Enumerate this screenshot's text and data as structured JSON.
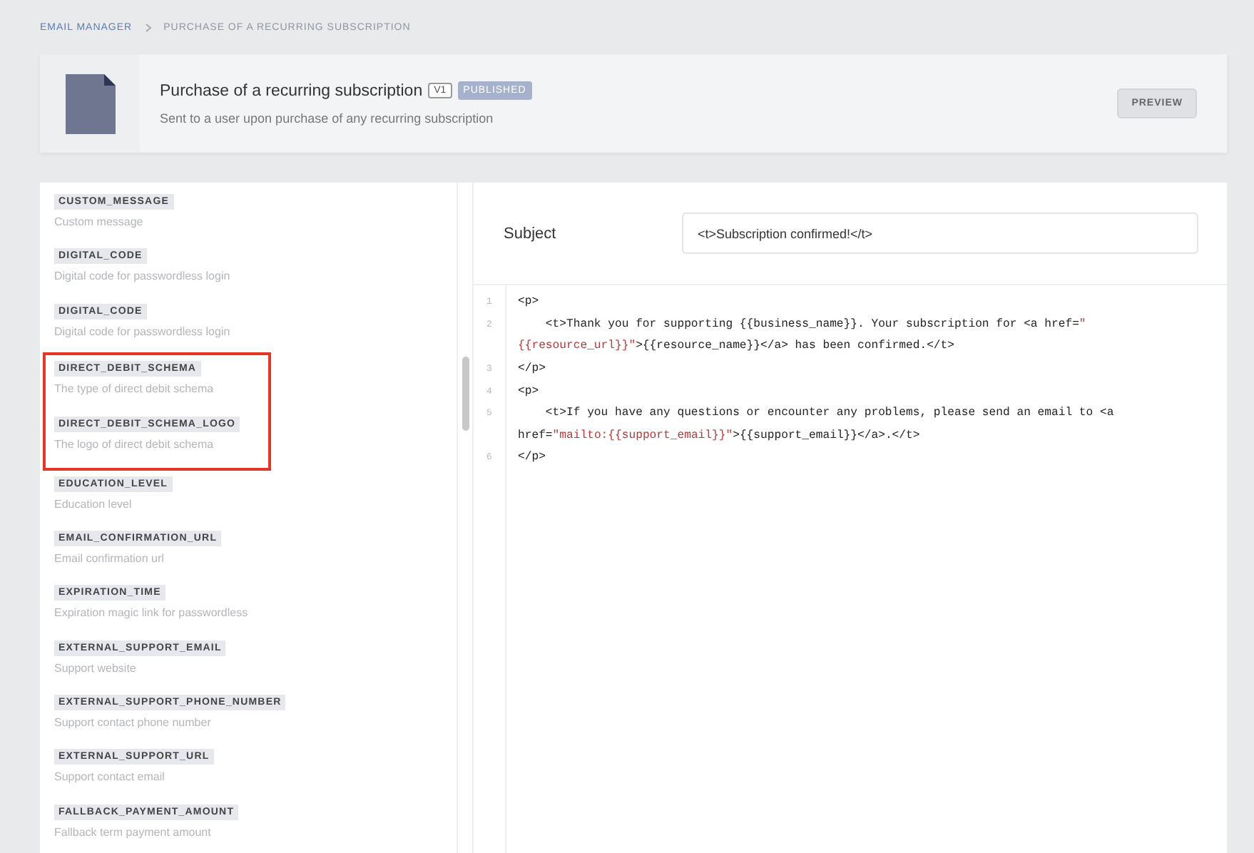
{
  "breadcrumb": [
    {
      "label": "EMAIL MANAGER",
      "kind": "link"
    },
    {
      "label": "PURCHASE OF A RECURRING SUBSCRIPTION",
      "kind": "current"
    }
  ],
  "header": {
    "title": "Purchase of a recurring subscription",
    "version": "V1",
    "status": "PUBLISHED",
    "description": "Sent to a user upon purchase of any recurring subscription",
    "button": "PREVIEW"
  },
  "variables": [
    {
      "name": "CUSTOM_MESSAGE",
      "description": "Custom message",
      "highlighted": false
    },
    {
      "name": "DIGITAL_CODE",
      "description": "Digital code for passwordless login",
      "highlighted": false
    },
    {
      "name": "DIGITAL_CODE",
      "description": "Digital code for passwordless login",
      "highlighted": false
    },
    {
      "name": "DIRECT_DEBIT_SCHEMA",
      "description": "The type of direct debit schema",
      "highlighted": true
    },
    {
      "name": "DIRECT_DEBIT_SCHEMA_LOGO",
      "description": "The logo of direct debit schema",
      "highlighted": true
    },
    {
      "name": "EDUCATION_LEVEL",
      "description": "Education level",
      "highlighted": false
    },
    {
      "name": "EMAIL_CONFIRMATION_URL",
      "description": "Email confirmation url",
      "highlighted": false
    },
    {
      "name": "EXPIRATION_TIME",
      "description": "Expiration magic link for passwordless",
      "highlighted": false
    },
    {
      "name": "EXTERNAL_SUPPORT_EMAIL",
      "description": "Support website",
      "highlighted": false
    },
    {
      "name": "EXTERNAL_SUPPORT_PHONE_NUMBER",
      "description": "Support contact phone number",
      "highlighted": false
    },
    {
      "name": "EXTERNAL_SUPPORT_URL",
      "description": "Support contact email",
      "highlighted": false
    },
    {
      "name": "FALLBACK_PAYMENT_AMOUNT",
      "description": "Fallback term payment amount",
      "highlighted": false
    }
  ],
  "subject": {
    "label": "Subject",
    "value": "<t>Subscription confirmed!</t>"
  },
  "code": [
    {
      "number": "1",
      "rows": [
        {
          "parts": [
            {
              "kind": "plain",
              "text": "<p>"
            }
          ]
        }
      ]
    },
    {
      "number": "2",
      "rows": [
        {
          "parts": [
            {
              "kind": "plain",
              "text": "    <t>Thank you for supporting {{business_name}}. Your subscription for <a href="
            },
            {
              "kind": "string",
              "text": "\""
            }
          ]
        },
        {
          "parts": [
            {
              "kind": "string",
              "text": "{{resource_url}}\""
            },
            {
              "kind": "plain",
              "text": ">{{resource_name}}</a> has been confirmed.</t>"
            }
          ]
        }
      ]
    },
    {
      "number": "3",
      "rows": [
        {
          "parts": [
            {
              "kind": "plain",
              "text": "</p>"
            }
          ]
        }
      ]
    },
    {
      "number": "4",
      "rows": [
        {
          "parts": [
            {
              "kind": "plain",
              "text": "<p>"
            }
          ]
        }
      ]
    },
    {
      "number": "5",
      "rows": [
        {
          "parts": [
            {
              "kind": "plain",
              "text": "    <t>If you have any questions or encounter any problems, please send an email to <a"
            }
          ]
        },
        {
          "parts": [
            {
              "kind": "plain",
              "text": "href="
            },
            {
              "kind": "string",
              "text": "\"mailto:{{support_email}}\""
            },
            {
              "kind": "plain",
              "text": ">{{support_email}}</a>.</t>"
            }
          ]
        }
      ]
    },
    {
      "number": "6",
      "rows": [
        {
          "parts": [
            {
              "kind": "plain",
              "text": "</p>"
            }
          ]
        }
      ]
    }
  ]
}
